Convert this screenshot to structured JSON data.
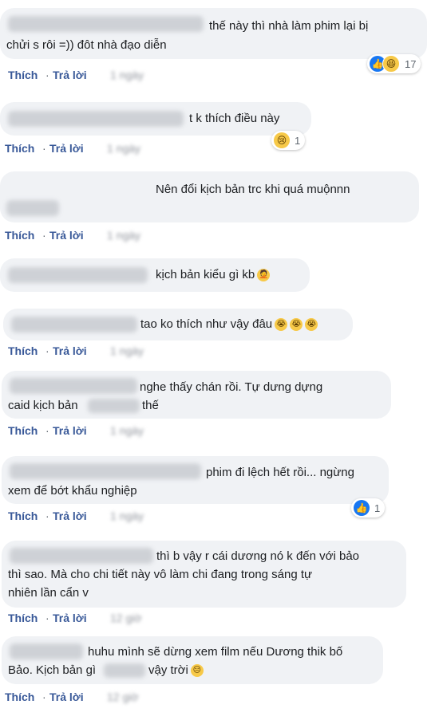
{
  "actions": {
    "like": "Thích",
    "reply": "Trả lời",
    "dot": "·"
  },
  "comments": [
    {
      "lines": [
        "thế này thì nhà làm phim lại bị",
        "chửi s     rôi =)) đôt nhà đạo diễn"
      ],
      "time": "1 ngày",
      "reaction_count": "17",
      "reaction_icons": [
        "like-icon",
        "haha-icon"
      ]
    },
    {
      "lines": [
        "t k thích điều này"
      ],
      "time": "1 ngày",
      "reaction_count": "1",
      "reaction_icons": [
        "sad-icon"
      ]
    },
    {
      "lines": [
        "Nên đổi kịch bản trc khi quá muộnnn"
      ],
      "time": "1 ngày"
    },
    {
      "lines": [
        "kịch bản kiểu gì kb"
      ],
      "emoji_icon": "facepalm-emoji-icon"
    },
    {
      "lines": [
        "tao ko thích như vậy đâu"
      ],
      "time": "1 ngày",
      "emoji_icons": [
        "crying-emoji-icon",
        "crying-emoji-icon",
        "crying-emoji-icon"
      ]
    },
    {
      "lines": [
        "nghe thấy chán rồi. Tự dưng dựng",
        "caid kịch bản",
        "thế"
      ],
      "time": "1 ngày"
    },
    {
      "lines": [
        "phim đi lệch hết rồi... ngừng",
        "xem để bớt khẩu nghiệp"
      ],
      "time": "1 ngày",
      "reaction_count": "1",
      "reaction_icons": [
        "like-icon"
      ]
    },
    {
      "lines": [
        "thì b vậy r cái dương nó k đến với bảo",
        "thì sao. Mà cho chi tiết này vô làm chi đang trong sáng tự",
        "nhiên lần cẩn v"
      ],
      "time": "12 giờ"
    },
    {
      "lines": [
        "huhu mình sẽ dừng xem film nếu Dương thik bố",
        "Bảo. Kịch bản gì",
        "vậy trời"
      ],
      "time": "12 giờ",
      "emoji_icon": "neutral-face-emoji-icon"
    }
  ],
  "colors": {
    "bubble": "#f0f2f5",
    "link": "#385898",
    "like_blue": "#1877f2",
    "emoji_yellow": "#f7c948"
  }
}
